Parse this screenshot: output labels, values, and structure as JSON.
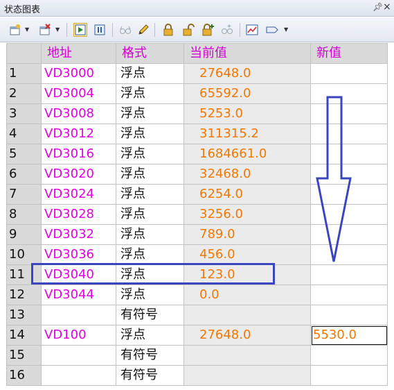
{
  "window": {
    "title": "状态图表"
  },
  "toolbar": {
    "icons": [
      "add-table-icon",
      "delete-table-icon",
      "trend-view-icon",
      "pause-icon",
      "glasses-icon",
      "pencil-icon",
      "lock-icon",
      "unlock-icon",
      "lock-all-icon",
      "read-all-icon",
      "chart-icon",
      "tag-icon"
    ]
  },
  "table": {
    "headers": {
      "address": "地址",
      "format": "格式",
      "current": "当前值",
      "new": "新值"
    },
    "rows": [
      {
        "index": "1",
        "address": "VD3000",
        "format": "浮点",
        "current": "27648.0",
        "new": ""
      },
      {
        "index": "2",
        "address": "VD3004",
        "format": "浮点",
        "current": "65592.0",
        "new": ""
      },
      {
        "index": "3",
        "address": "VD3008",
        "format": "浮点",
        "current": "5253.0",
        "new": ""
      },
      {
        "index": "4",
        "address": "VD3012",
        "format": "浮点",
        "current": "311315.2",
        "new": ""
      },
      {
        "index": "5",
        "address": "VD3016",
        "format": "浮点",
        "current": "1684661.0",
        "new": ""
      },
      {
        "index": "6",
        "address": "VD3020",
        "format": "浮点",
        "current": "32468.0",
        "new": ""
      },
      {
        "index": "7",
        "address": "VD3024",
        "format": "浮点",
        "current": "6254.0",
        "new": ""
      },
      {
        "index": "8",
        "address": "VD3028",
        "format": "浮点",
        "current": "3256.0",
        "new": ""
      },
      {
        "index": "9",
        "address": "VD3032",
        "format": "浮点",
        "current": "789.0",
        "new": ""
      },
      {
        "index": "10",
        "address": "VD3036",
        "format": "浮点",
        "current": "456.0",
        "new": ""
      },
      {
        "index": "11",
        "address": "VD3040",
        "format": "浮点",
        "current": "123.0",
        "new": ""
      },
      {
        "index": "12",
        "address": "VD3044",
        "format": "浮点",
        "current": "0.0",
        "new": ""
      },
      {
        "index": "13",
        "address": "",
        "format": "有符号",
        "current": "",
        "new": ""
      },
      {
        "index": "14",
        "address": "VD100",
        "format": "浮点",
        "current": "27648.0",
        "new": "5530.0"
      },
      {
        "index": "15",
        "address": "",
        "format": "有符号",
        "current": "",
        "new": ""
      },
      {
        "index": "16",
        "address": "",
        "format": "有符号",
        "current": "",
        "new": ""
      }
    ]
  },
  "colors": {
    "address": "#e000e0",
    "value": "#f07800",
    "annotation": "#3a46c0"
  }
}
